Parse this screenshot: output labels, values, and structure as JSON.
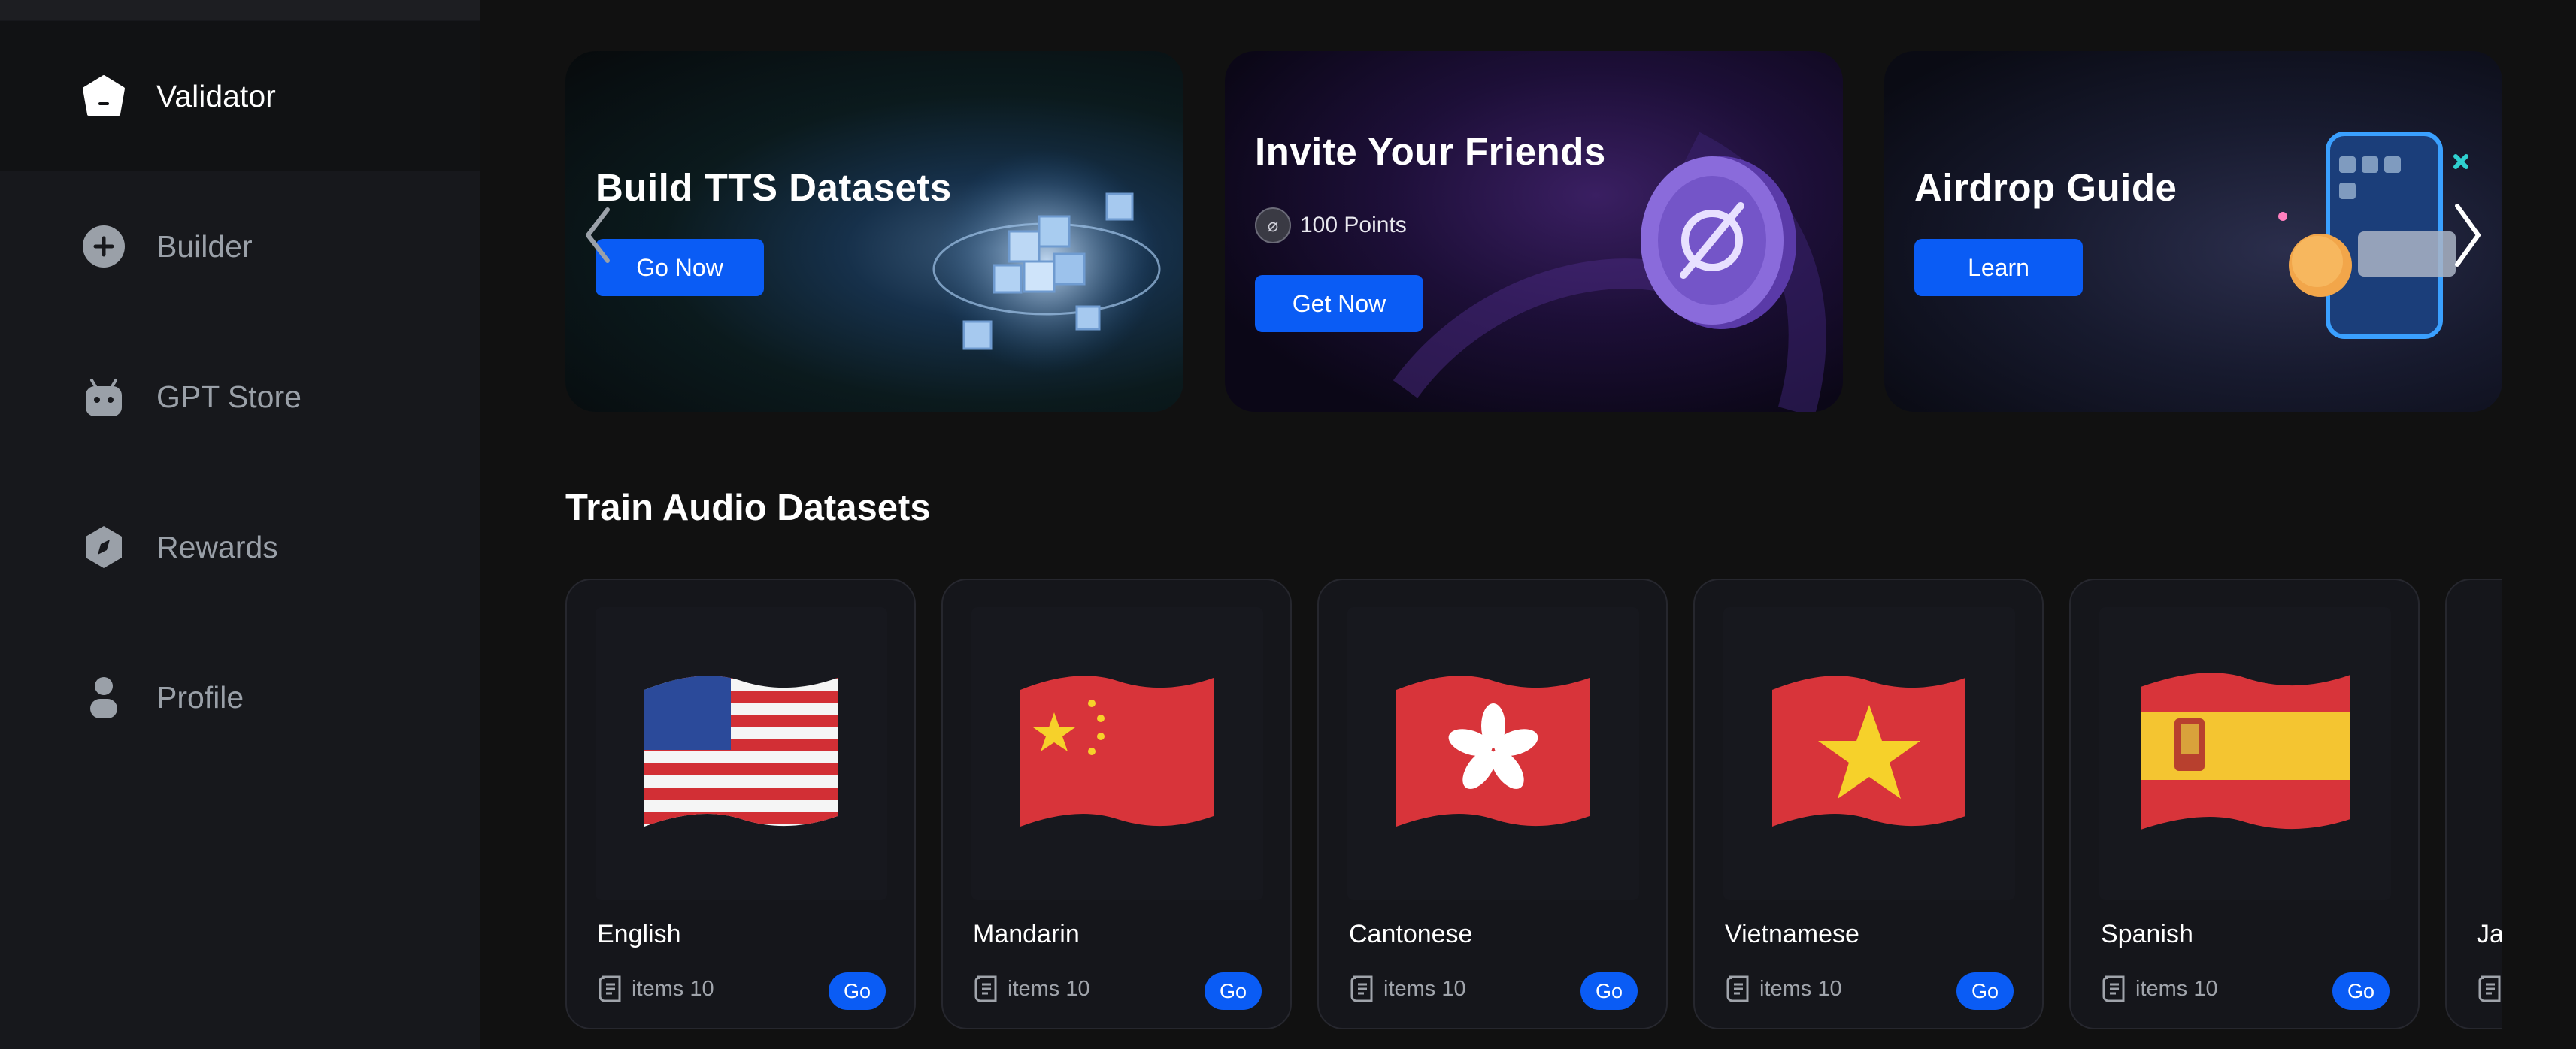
{
  "sidebar": {
    "items": [
      {
        "label": "Validator",
        "icon": "pentagon-icon",
        "active": true
      },
      {
        "label": "Builder",
        "icon": "plus-circle-icon",
        "active": false
      },
      {
        "label": "GPT Store",
        "icon": "robot-icon",
        "active": false
      },
      {
        "label": "Rewards",
        "icon": "compass-icon",
        "active": false
      },
      {
        "label": "Profile",
        "icon": "user-icon",
        "active": false
      }
    ]
  },
  "banners": [
    {
      "title": "Build TTS Datasets",
      "button": "Go Now"
    },
    {
      "title": "Invite Your Friends",
      "points": "100 Points",
      "button": "Get Now"
    },
    {
      "title": "Airdrop Guide",
      "button": "Learn"
    }
  ],
  "section": {
    "title": "Train Audio Datasets"
  },
  "datasets": [
    {
      "language": "English",
      "items": "items 10",
      "button": "Go"
    },
    {
      "language": "Mandarin",
      "items": "items 10",
      "button": "Go"
    },
    {
      "language": "Cantonese",
      "items": "items 10",
      "button": "Go"
    },
    {
      "language": "Vietnamese",
      "items": "items 10",
      "button": "Go"
    },
    {
      "language": "Spanish",
      "items": "items 10",
      "button": "Go"
    },
    {
      "language": "Ja",
      "items": "",
      "button": ""
    }
  ],
  "colors": {
    "accent": "#0a5cf5",
    "background": "#111111",
    "sidebar": "#17181c"
  }
}
